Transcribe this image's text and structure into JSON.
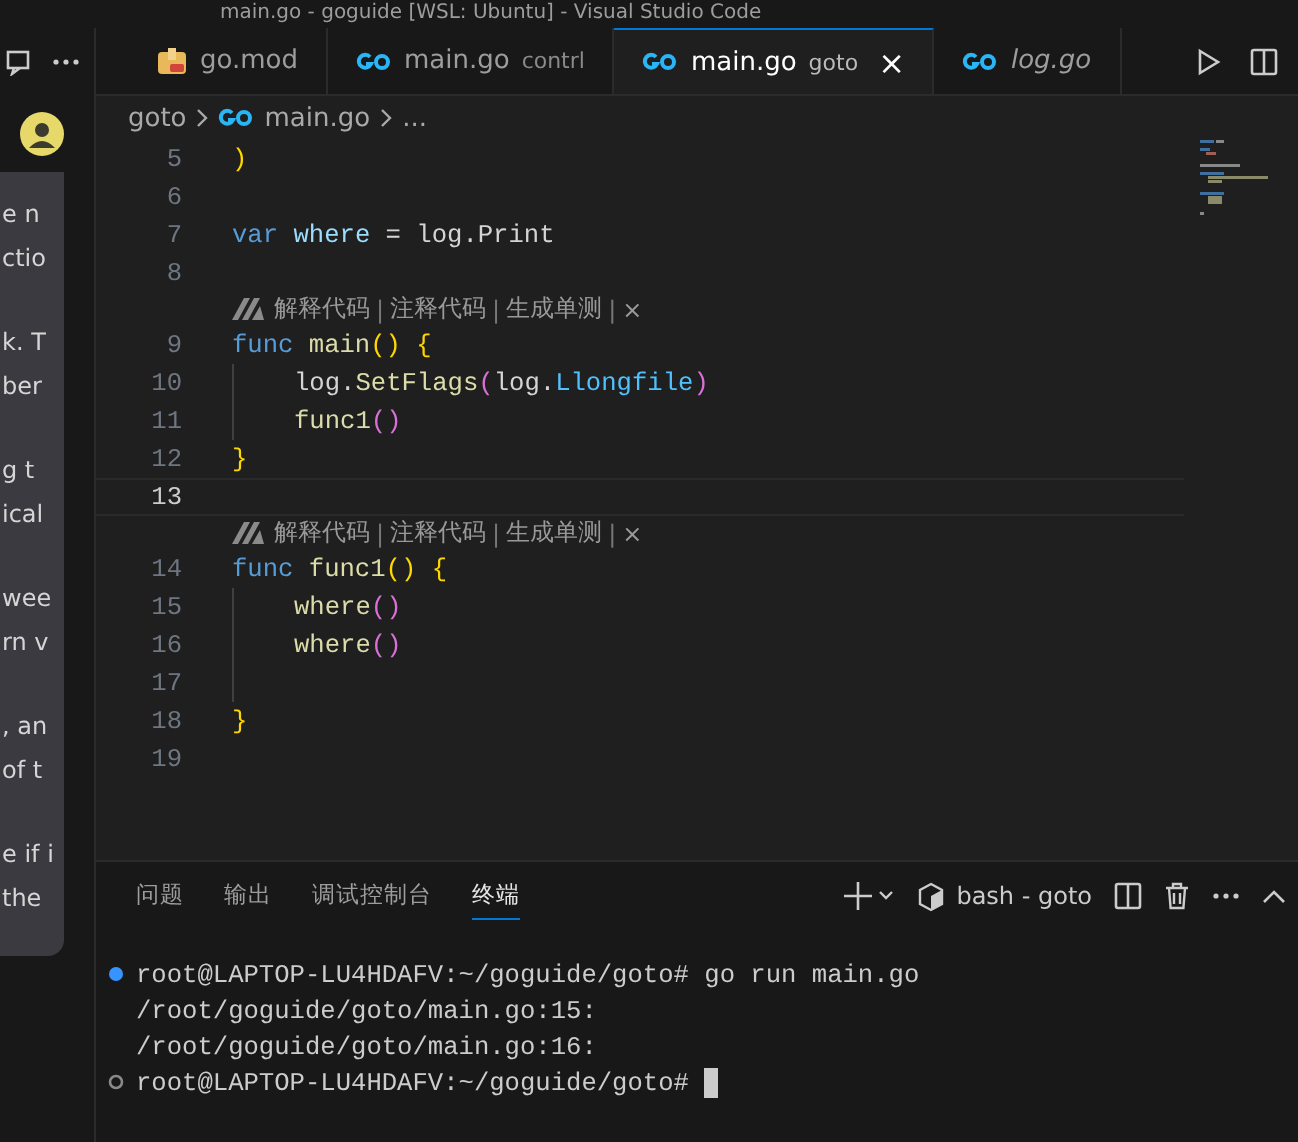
{
  "window": {
    "title": "main.go - goguide [WSL: Ubuntu] - Visual Studio Code"
  },
  "chat_panel": {
    "paragraphs": [
      [
        "e n",
        "ctio"
      ],
      [
        "k. T",
        "ber"
      ],
      [
        "g t",
        "ical"
      ],
      [
        "wee",
        "rn v"
      ],
      [
        ", an",
        "of t"
      ],
      [
        "e if i",
        "the"
      ]
    ]
  },
  "tabs": [
    {
      "kind": "mod",
      "label": "go.mod",
      "selected": false,
      "preview": false
    },
    {
      "kind": "go",
      "label": "main.go",
      "description": "contrl",
      "selected": false,
      "preview": false
    },
    {
      "kind": "go",
      "label": "main.go",
      "description": "goto",
      "selected": true,
      "preview": false,
      "close": "×"
    },
    {
      "kind": "go",
      "label": "log.go",
      "selected": false,
      "preview": true
    }
  ],
  "breadcrumb": [
    {
      "kind": "folder",
      "label": "goto"
    },
    {
      "kind": "go",
      "label": "main.go"
    },
    {
      "kind": "more",
      "label": "..."
    }
  ],
  "editor": {
    "lines": [
      {
        "kind": "code",
        "number": "5",
        "current": false,
        "tokens": [
          {
            "text": ")",
            "color": "#ffd700"
          }
        ]
      },
      {
        "kind": "code",
        "number": "6",
        "current": false
      },
      {
        "kind": "code",
        "number": "7",
        "current": false,
        "tokens": [
          {
            "text": "var",
            "color": "#569cd6"
          },
          {
            "text": " where",
            "color": "#9cdcfe"
          },
          {
            "text": " = log.Print",
            "color": "#d4d4d4"
          }
        ]
      },
      {
        "kind": "code",
        "number": "8",
        "current": false
      },
      {
        "kind": "codelens",
        "actions": [
          "解释代码",
          "注释代码",
          "生成单测"
        ],
        "separator": "|",
        "close": "×"
      },
      {
        "kind": "code",
        "number": "9",
        "current": false,
        "tokens": [
          {
            "text": "func",
            "color": "#569cd6"
          },
          {
            "text": " main",
            "color": "#dcdcaa"
          },
          {
            "text": "() {",
            "color": "#ffd700"
          }
        ]
      },
      {
        "kind": "code",
        "number": "10",
        "current": false,
        "indent": true,
        "tokens": [
          {
            "text": "log.",
            "color": "#d4d4d4"
          },
          {
            "text": "SetFlags",
            "color": "#dcdcaa"
          },
          {
            "text": "(",
            "color": "#da70d6"
          },
          {
            "text": "log.",
            "color": "#d4d4d4"
          },
          {
            "text": "Llongfile",
            "color": "#4fc1ff"
          },
          {
            "text": ")",
            "color": "#da70d6"
          }
        ]
      },
      {
        "kind": "code",
        "number": "11",
        "current": false,
        "indent": true,
        "tokens": [
          {
            "text": "func1",
            "color": "#dcdcaa"
          },
          {
            "text": "()",
            "color": "#da70d6"
          }
        ]
      },
      {
        "kind": "code",
        "number": "12",
        "current": false,
        "tokens": [
          {
            "text": "}",
            "color": "#ffd700"
          }
        ]
      },
      {
        "kind": "code",
        "number": "13",
        "current": true
      },
      {
        "kind": "codelens",
        "actions": [
          "解释代码",
          "注释代码",
          "生成单测"
        ],
        "separator": "|",
        "close": "×"
      },
      {
        "kind": "code",
        "number": "14",
        "current": false,
        "tokens": [
          {
            "text": "func",
            "color": "#569cd6"
          },
          {
            "text": " func1",
            "color": "#dcdcaa"
          },
          {
            "text": "() {",
            "color": "#ffd700"
          }
        ]
      },
      {
        "kind": "code",
        "number": "15",
        "current": false,
        "indent": true,
        "tokens": [
          {
            "text": "where",
            "color": "#dcdcaa"
          },
          {
            "text": "()",
            "color": "#da70d6"
          }
        ]
      },
      {
        "kind": "code",
        "number": "16",
        "current": false,
        "indent": true,
        "tokens": [
          {
            "text": "where",
            "color": "#dcdcaa"
          },
          {
            "text": "()",
            "color": "#da70d6"
          }
        ]
      },
      {
        "kind": "code",
        "number": "17",
        "current": false,
        "indent": true
      },
      {
        "kind": "code",
        "number": "18",
        "current": false,
        "tokens": [
          {
            "text": "}",
            "color": "#ffd700"
          }
        ]
      },
      {
        "kind": "code",
        "number": "19",
        "current": false
      }
    ]
  },
  "panel": {
    "tabs": [
      {
        "label": "问题",
        "selected": false
      },
      {
        "label": "输出",
        "selected": false
      },
      {
        "label": "调试控制台",
        "selected": false
      },
      {
        "label": "终端",
        "selected": true
      }
    ],
    "terminal_name": "bash - goto",
    "lines": [
      {
        "kind": "command",
        "text": "root@LAPTOP-LU4HDAFV:~/goguide/goto# go run main.go"
      },
      {
        "kind": "output",
        "text": "/root/goguide/goto/main.go:15:"
      },
      {
        "kind": "output",
        "text": "/root/goguide/goto/main.go:16:"
      },
      {
        "kind": "prompt",
        "text": "root@LAPTOP-LU4HDAFV:~/goguide/goto#",
        "cursor": true
      }
    ]
  }
}
